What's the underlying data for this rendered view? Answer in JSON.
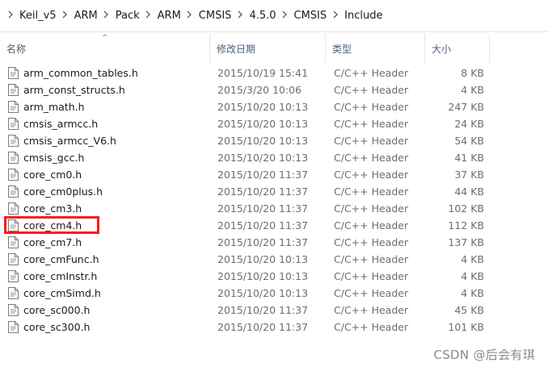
{
  "breadcrumb": [
    "Keil_v5",
    "ARM",
    "Pack",
    "ARM",
    "CMSIS",
    "4.5.0",
    "CMSIS",
    "Include"
  ],
  "columns": {
    "name": "名称",
    "date": "修改日期",
    "type": "类型",
    "size": "大小"
  },
  "files": [
    {
      "name": "arm_common_tables.h",
      "date": "2015/10/19 15:41",
      "type": "C/C++ Header",
      "size": "8 KB"
    },
    {
      "name": "arm_const_structs.h",
      "date": "2015/3/20 10:06",
      "type": "C/C++ Header",
      "size": "4 KB"
    },
    {
      "name": "arm_math.h",
      "date": "2015/10/20 10:13",
      "type": "C/C++ Header",
      "size": "247 KB"
    },
    {
      "name": "cmsis_armcc.h",
      "date": "2015/10/20 10:13",
      "type": "C/C++ Header",
      "size": "24 KB"
    },
    {
      "name": "cmsis_armcc_V6.h",
      "date": "2015/10/20 10:13",
      "type": "C/C++ Header",
      "size": "54 KB"
    },
    {
      "name": "cmsis_gcc.h",
      "date": "2015/10/20 10:13",
      "type": "C/C++ Header",
      "size": "41 KB"
    },
    {
      "name": "core_cm0.h",
      "date": "2015/10/20 11:37",
      "type": "C/C++ Header",
      "size": "37 KB"
    },
    {
      "name": "core_cm0plus.h",
      "date": "2015/10/20 11:37",
      "type": "C/C++ Header",
      "size": "44 KB"
    },
    {
      "name": "core_cm3.h",
      "date": "2015/10/20 11:37",
      "type": "C/C++ Header",
      "size": "102 KB"
    },
    {
      "name": "core_cm4.h",
      "date": "2015/10/20 11:37",
      "type": "C/C++ Header",
      "size": "112 KB"
    },
    {
      "name": "core_cm7.h",
      "date": "2015/10/20 11:37",
      "type": "C/C++ Header",
      "size": "137 KB"
    },
    {
      "name": "core_cmFunc.h",
      "date": "2015/10/20 10:13",
      "type": "C/C++ Header",
      "size": "4 KB"
    },
    {
      "name": "core_cmInstr.h",
      "date": "2015/10/20 10:13",
      "type": "C/C++ Header",
      "size": "4 KB"
    },
    {
      "name": "core_cmSimd.h",
      "date": "2015/10/20 10:13",
      "type": "C/C++ Header",
      "size": "4 KB"
    },
    {
      "name": "core_sc000.h",
      "date": "2015/10/20 11:37",
      "type": "C/C++ Header",
      "size": "45 KB"
    },
    {
      "name": "core_sc300.h",
      "date": "2015/10/20 11:37",
      "type": "C/C++ Header",
      "size": "101 KB"
    }
  ],
  "watermark": "CSDN @后会有琪",
  "colors": {
    "highlight": "#ff1a1a",
    "header_text": "#4c607a"
  },
  "icons": {
    "file": "c-header-file-icon",
    "sort": "sort-up-arrow-icon",
    "separator": "chevron-right-icon"
  }
}
